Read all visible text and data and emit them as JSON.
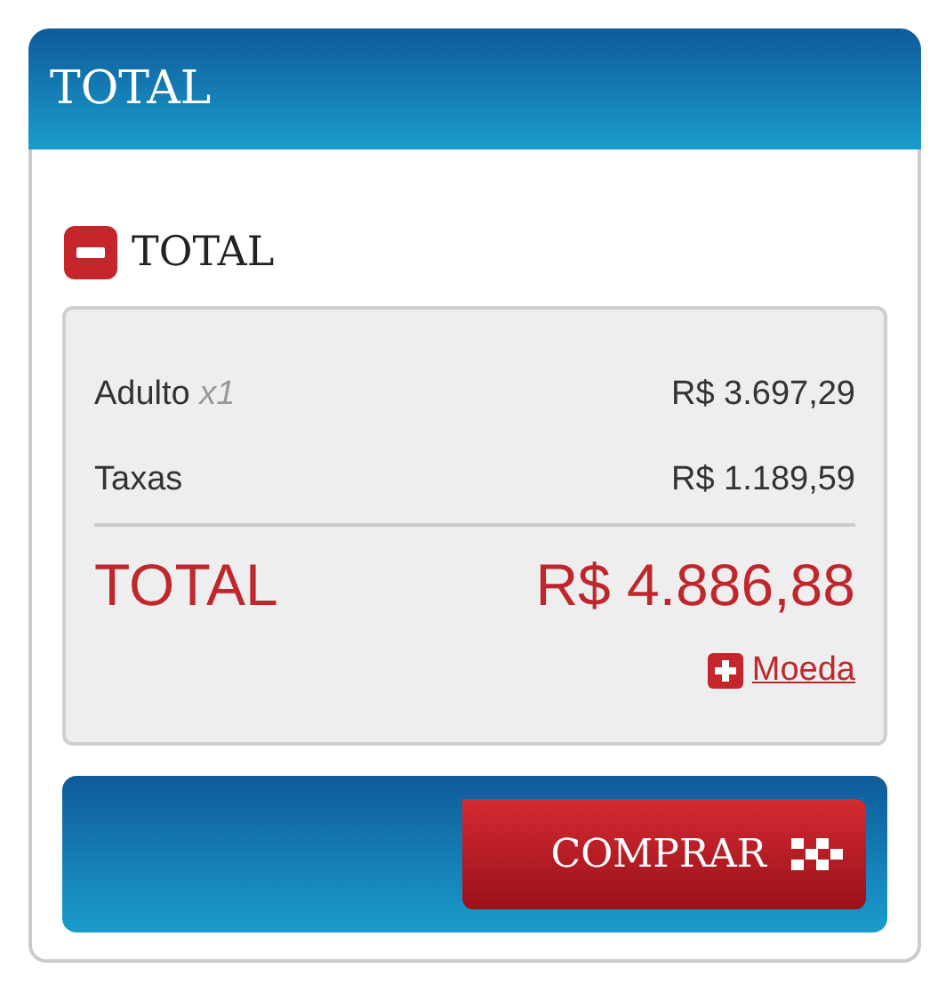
{
  "panel": {
    "title": "TOTAL"
  },
  "section": {
    "title": "TOTAL",
    "expanded": true
  },
  "lines": [
    {
      "label": "Adulto",
      "qualifier": "x1",
      "amount": "R$ 3.697,29"
    },
    {
      "label": "Taxas",
      "amount": "R$ 1.189,59"
    }
  ],
  "total": {
    "label": "TOTAL",
    "amount": "R$ 4.886,88"
  },
  "currency_link": "Moeda",
  "buy_button": "COMPRAR"
}
